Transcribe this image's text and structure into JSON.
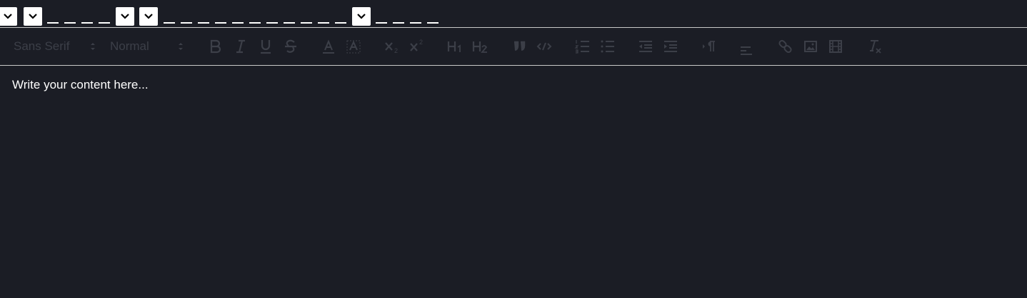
{
  "toolbar": {
    "font_picker": {
      "selected": "Sans Serif",
      "icon": "chevron-updown-icon"
    },
    "size_picker": {
      "selected": "Normal",
      "icon": "chevron-updown-icon"
    },
    "buttons": [
      "bold-icon",
      "italic-icon",
      "underline-icon",
      "strikethrough-icon",
      "text-color-icon",
      "background-color-icon",
      "subscript-icon",
      "superscript-icon",
      "header-1-icon",
      "header-2-icon",
      "blockquote-icon",
      "code-block-icon",
      "ordered-list-icon",
      "bullet-list-icon",
      "outdent-icon",
      "indent-icon",
      "text-direction-icon",
      "align-icon",
      "link-icon",
      "image-icon",
      "video-icon",
      "clean-format-icon"
    ],
    "icon_color": "#3c3f48"
  },
  "editor": {
    "content": "Write your content here..."
  },
  "colors": {
    "background": "#1b1d25",
    "separator": "#c8c8c8",
    "text": "#ffffff"
  }
}
